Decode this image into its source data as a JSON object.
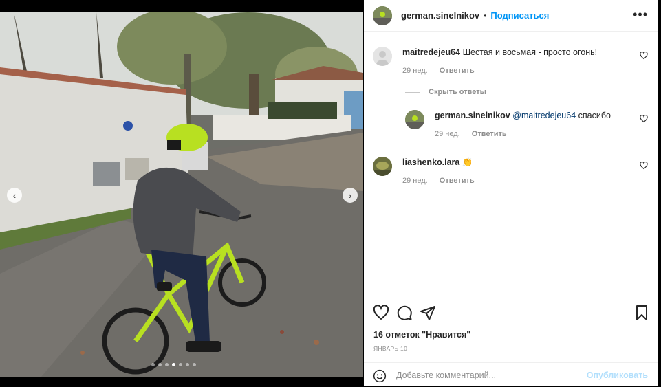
{
  "post": {
    "author": "german.sinelnikov",
    "separator": "•",
    "follow_label": "Подписаться",
    "more_label": "•••",
    "media": {
      "slide_count": 7,
      "active_slide": 3,
      "prev_label": "‹",
      "next_label": "›"
    }
  },
  "comments": [
    {
      "user": "maitredejeu64",
      "text": "Шестая и восьмая - просто огонь!",
      "time": "29 нед.",
      "reply_label": "Ответить"
    }
  ],
  "hide_replies_label": "Скрыть ответы",
  "replies": [
    {
      "user": "german.sinelnikov",
      "mention": "@maitredejeu64",
      "text": "спасибо",
      "time": "29 нед.",
      "reply_label": "Ответить"
    }
  ],
  "comments2": [
    {
      "user": "liashenko.lara",
      "text": "👏",
      "time": "29 нед.",
      "reply_label": "Ответить"
    }
  ],
  "actions": {
    "likes": "16 отметок \"Нравится\"",
    "date": "Январь 10"
  },
  "comment_box": {
    "placeholder": "Добавьте комментарий...",
    "publish_label": "Опубликовать"
  },
  "colors": {
    "link_blue": "#0095f6",
    "publish_disabled": "#b2dffc",
    "meta_gray": "#8e8e8e",
    "helmet_green": "#b8e021"
  }
}
